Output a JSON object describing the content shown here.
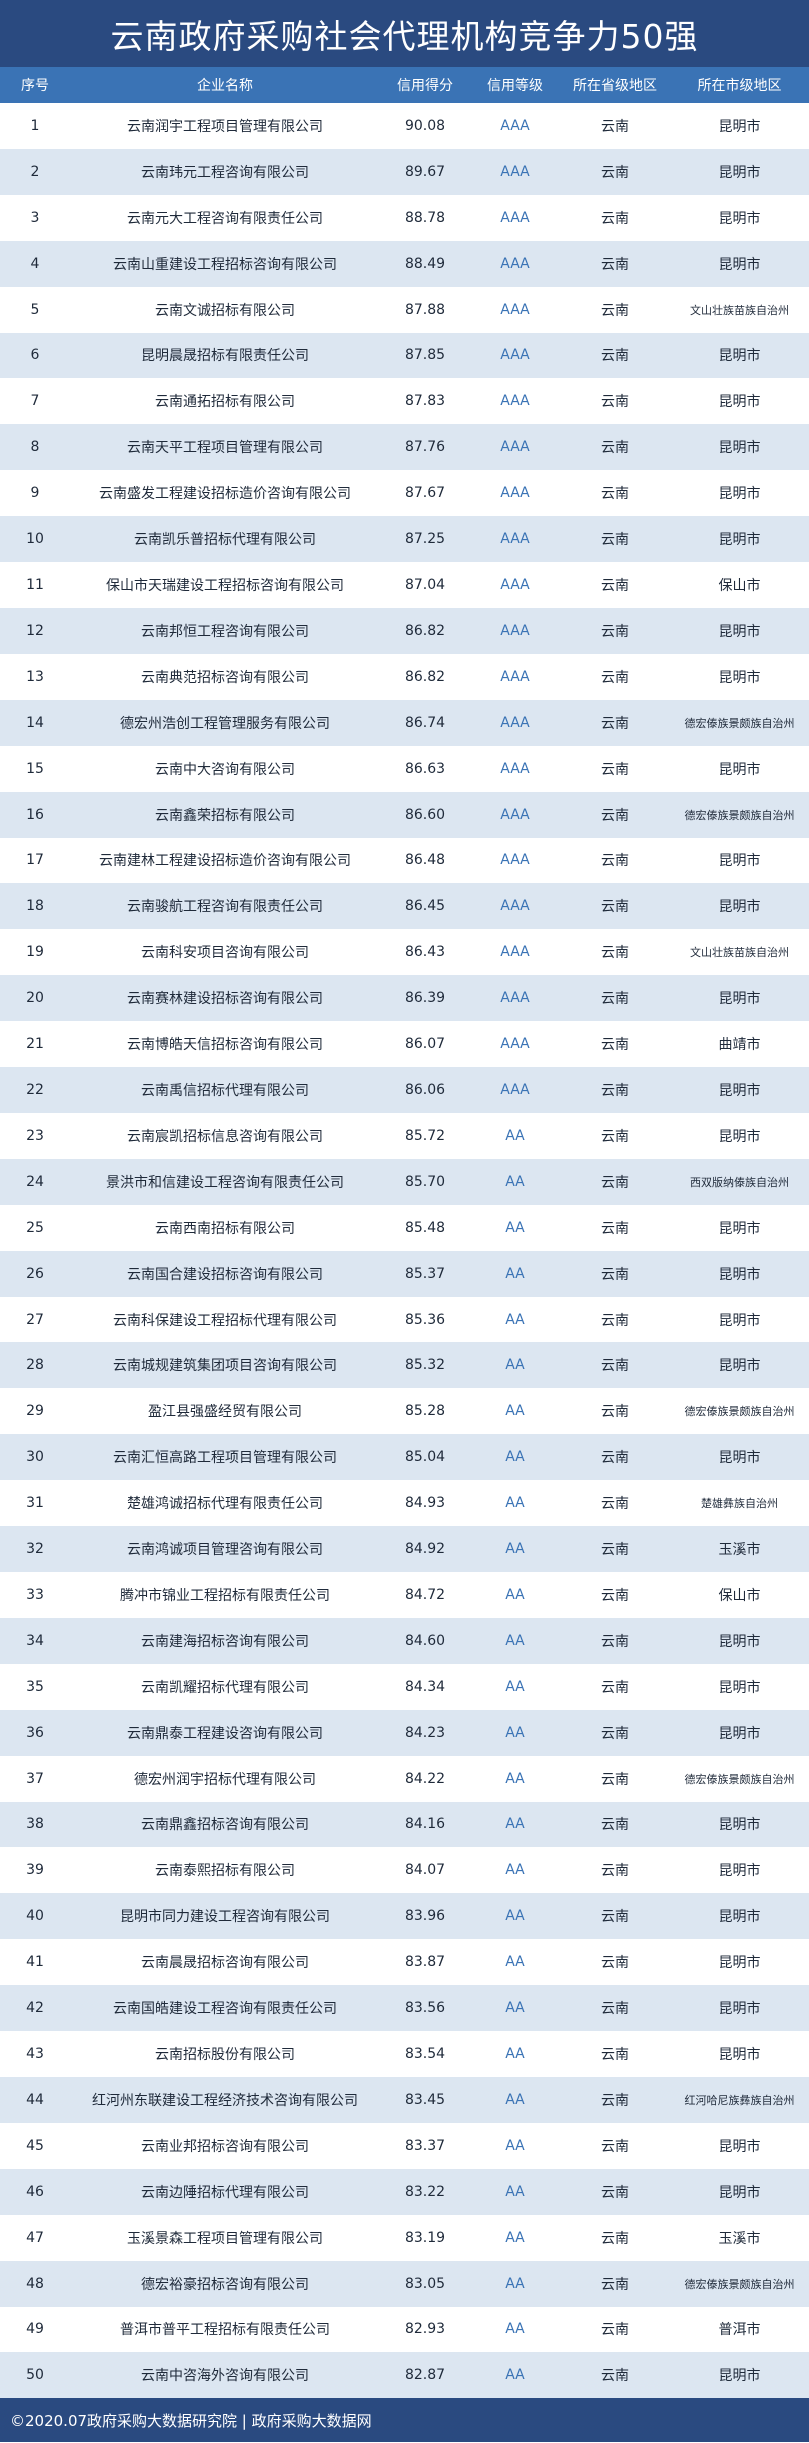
{
  "title": "云南政府采购社会代理机构竞争力50强",
  "columns": [
    "序号",
    "企业名称",
    "信用得分",
    "信用等级",
    "所在省级地区",
    "所在市级地区"
  ],
  "rows": [
    [
      "1",
      "云南润宇工程项目管理有限公司",
      "90.08",
      "AAA",
      "云南",
      "昆明市"
    ],
    [
      "2",
      "云南玮元工程咨询有限公司",
      "89.67",
      "AAA",
      "云南",
      "昆明市"
    ],
    [
      "3",
      "云南元大工程咨询有限责任公司",
      "88.78",
      "AAA",
      "云南",
      "昆明市"
    ],
    [
      "4",
      "云南山重建设工程招标咨询有限公司",
      "88.49",
      "AAA",
      "云南",
      "昆明市"
    ],
    [
      "5",
      "云南文诚招标有限公司",
      "87.88",
      "AAA",
      "云南",
      "文山壮族苗族自治州"
    ],
    [
      "6",
      "昆明晨晟招标有限责任公司",
      "87.85",
      "AAA",
      "云南",
      "昆明市"
    ],
    [
      "7",
      "云南通拓招标有限公司",
      "87.83",
      "AAA",
      "云南",
      "昆明市"
    ],
    [
      "8",
      "云南天平工程项目管理有限公司",
      "87.76",
      "AAA",
      "云南",
      "昆明市"
    ],
    [
      "9",
      "云南盛发工程建设招标造价咨询有限公司",
      "87.67",
      "AAA",
      "云南",
      "昆明市"
    ],
    [
      "10",
      "云南凯乐普招标代理有限公司",
      "87.25",
      "AAA",
      "云南",
      "昆明市"
    ],
    [
      "11",
      "保山市天瑞建设工程招标咨询有限公司",
      "87.04",
      "AAA",
      "云南",
      "保山市"
    ],
    [
      "12",
      "云南邦恒工程咨询有限公司",
      "86.82",
      "AAA",
      "云南",
      "昆明市"
    ],
    [
      "13",
      "云南典范招标咨询有限公司",
      "86.82",
      "AAA",
      "云南",
      "昆明市"
    ],
    [
      "14",
      "德宏州浩创工程管理服务有限公司",
      "86.74",
      "AAA",
      "云南",
      "德宏傣族景颇族自治州"
    ],
    [
      "15",
      "云南中大咨询有限公司",
      "86.63",
      "AAA",
      "云南",
      "昆明市"
    ],
    [
      "16",
      "云南鑫荣招标有限公司",
      "86.60",
      "AAA",
      "云南",
      "德宏傣族景颇族自治州"
    ],
    [
      "17",
      "云南建林工程建设招标造价咨询有限公司",
      "86.48",
      "AAA",
      "云南",
      "昆明市"
    ],
    [
      "18",
      "云南骏航工程咨询有限责任公司",
      "86.45",
      "AAA",
      "云南",
      "昆明市"
    ],
    [
      "19",
      "云南科安项目咨询有限公司",
      "86.43",
      "AAA",
      "云南",
      "文山壮族苗族自治州"
    ],
    [
      "20",
      "云南赛林建设招标咨询有限公司",
      "86.39",
      "AAA",
      "云南",
      "昆明市"
    ],
    [
      "21",
      "云南博皓天信招标咨询有限公司",
      "86.07",
      "AAA",
      "云南",
      "曲靖市"
    ],
    [
      "22",
      "云南禹信招标代理有限公司",
      "86.06",
      "AAA",
      "云南",
      "昆明市"
    ],
    [
      "23",
      "云南宸凯招标信息咨询有限公司",
      "85.72",
      "AA",
      "云南",
      "昆明市"
    ],
    [
      "24",
      "景洪市和信建设工程咨询有限责任公司",
      "85.70",
      "AA",
      "云南",
      "西双版纳傣族自治州"
    ],
    [
      "25",
      "云南西南招标有限公司",
      "85.48",
      "AA",
      "云南",
      "昆明市"
    ],
    [
      "26",
      "云南国合建设招标咨询有限公司",
      "85.37",
      "AA",
      "云南",
      "昆明市"
    ],
    [
      "27",
      "云南科保建设工程招标代理有限公司",
      "85.36",
      "AA",
      "云南",
      "昆明市"
    ],
    [
      "28",
      "云南城规建筑集团项目咨询有限公司",
      "85.32",
      "AA",
      "云南",
      "昆明市"
    ],
    [
      "29",
      "盈江县强盛经贸有限公司",
      "85.28",
      "AA",
      "云南",
      "德宏傣族景颇族自治州"
    ],
    [
      "30",
      "云南汇恒高路工程项目管理有限公司",
      "85.04",
      "AA",
      "云南",
      "昆明市"
    ],
    [
      "31",
      "楚雄鸿诚招标代理有限责任公司",
      "84.93",
      "AA",
      "云南",
      "楚雄彝族自治州"
    ],
    [
      "32",
      "云南鸿诚项目管理咨询有限公司",
      "84.92",
      "AA",
      "云南",
      "玉溪市"
    ],
    [
      "33",
      "腾冲市锦业工程招标有限责任公司",
      "84.72",
      "AA",
      "云南",
      "保山市"
    ],
    [
      "34",
      "云南建海招标咨询有限公司",
      "84.60",
      "AA",
      "云南",
      "昆明市"
    ],
    [
      "35",
      "云南凯耀招标代理有限公司",
      "84.34",
      "AA",
      "云南",
      "昆明市"
    ],
    [
      "36",
      "云南鼎泰工程建设咨询有限公司",
      "84.23",
      "AA",
      "云南",
      "昆明市"
    ],
    [
      "37",
      "德宏州润宇招标代理有限公司",
      "84.22",
      "AA",
      "云南",
      "德宏傣族景颇族自治州"
    ],
    [
      "38",
      "云南鼎鑫招标咨询有限公司",
      "84.16",
      "AA",
      "云南",
      "昆明市"
    ],
    [
      "39",
      "云南泰熙招标有限公司",
      "84.07",
      "AA",
      "云南",
      "昆明市"
    ],
    [
      "40",
      "昆明市同力建设工程咨询有限公司",
      "83.96",
      "AA",
      "云南",
      "昆明市"
    ],
    [
      "41",
      "云南晨晟招标咨询有限公司",
      "83.87",
      "AA",
      "云南",
      "昆明市"
    ],
    [
      "42",
      "云南国皓建设工程咨询有限责任公司",
      "83.56",
      "AA",
      "云南",
      "昆明市"
    ],
    [
      "43",
      "云南招标股份有限公司",
      "83.54",
      "AA",
      "云南",
      "昆明市"
    ],
    [
      "44",
      "红河州东联建设工程经济技术咨询有限公司",
      "83.45",
      "AA",
      "云南",
      "红河哈尼族彝族自治州"
    ],
    [
      "45",
      "云南业邦招标咨询有限公司",
      "83.37",
      "AA",
      "云南",
      "昆明市"
    ],
    [
      "46",
      "云南边陲招标代理有限公司",
      "83.22",
      "AA",
      "云南",
      "昆明市"
    ],
    [
      "47",
      "玉溪景森工程项目管理有限公司",
      "83.19",
      "AA",
      "云南",
      "玉溪市"
    ],
    [
      "48",
      "德宏裕豪招标咨询有限公司",
      "83.05",
      "AA",
      "云南",
      "德宏傣族景颇族自治州"
    ],
    [
      "49",
      "普洱市普平工程招标有限责任公司",
      "82.93",
      "AA",
      "云南",
      "普洱市"
    ],
    [
      "50",
      "云南中咨海外咨询有限公司",
      "82.87",
      "AA",
      "云南",
      "昆明市"
    ]
  ],
  "footer": "©2020.07政府采购大数据研究院 | 政府采购大数据网"
}
